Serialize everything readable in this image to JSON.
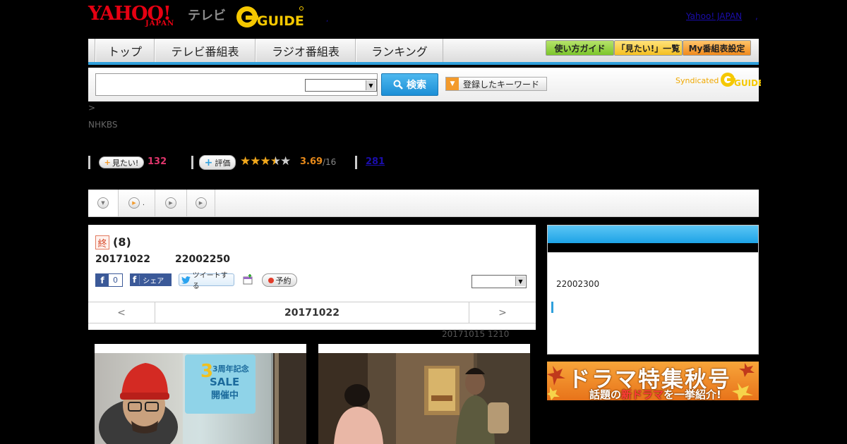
{
  "header": {
    "logo_yahoo": "YAHOO!",
    "logo_japan": "JAPAN",
    "logo_tv": "テレビ",
    "logo_gguide": "G GUIDE",
    "yahoo_japan_link": "Yahoo! JAPAN",
    "trailing_link": ",",
    "small_link": ","
  },
  "nav": {
    "tabs": [
      "トップ",
      "テレビ番組表",
      "ラジオ番組表",
      "ランキング"
    ],
    "guide_buttons": [
      {
        "label": "使い方ガイド",
        "color": "#8ccf3c"
      },
      {
        "label": "「見たい!」一覧",
        "color": "#f7c83a"
      },
      {
        "label": "My番組表設定",
        "color": "#f49b2b"
      }
    ],
    "accent_color": "#2fa0dc"
  },
  "search": {
    "query": "",
    "select_value": "",
    "button_label": "検索",
    "keyword_button_label": "登録したキーワード",
    "syndicated_label": "Syndicated"
  },
  "breadcrumb": ">",
  "station": "NHKBS",
  "stats": {
    "mitai_label": "見たい!",
    "mitai_count": "132",
    "eval_label": "評価",
    "stars": "★★★★☆",
    "rating": 3.69,
    "score": "3.69",
    "score_count": "/16",
    "review_count": "281"
  },
  "tabs": [
    {
      "icon": "chevron-down-icon",
      "label": ""
    },
    {
      "icon": "play-icon",
      "label": "."
    },
    {
      "icon": "play-icon",
      "label": ""
    },
    {
      "icon": "play-icon",
      "label": ""
    }
  ],
  "program": {
    "end_badge": "終",
    "episode": "(8)",
    "date": "20171022",
    "time": "22002250",
    "fb_like_count": "0",
    "fb_share_label": "シェア",
    "tweet_label": "ツイートする",
    "reserve_label": "予約",
    "select_value": "",
    "prev_label": "<",
    "next_label": ">",
    "nav_date": "20171022",
    "updated": "20171015  1210"
  },
  "sidebar": {
    "box_text": "22002300",
    "banner_line1": "ドラマ特集秋号",
    "banner_line2_a": "話題の",
    "banner_line2_b": "新ドラマ",
    "banner_line2_c": "を一挙紹介!"
  },
  "photos": {
    "sale_line1": "3周年記念",
    "sale_line2": "SALE",
    "sale_line3": "開催中"
  }
}
